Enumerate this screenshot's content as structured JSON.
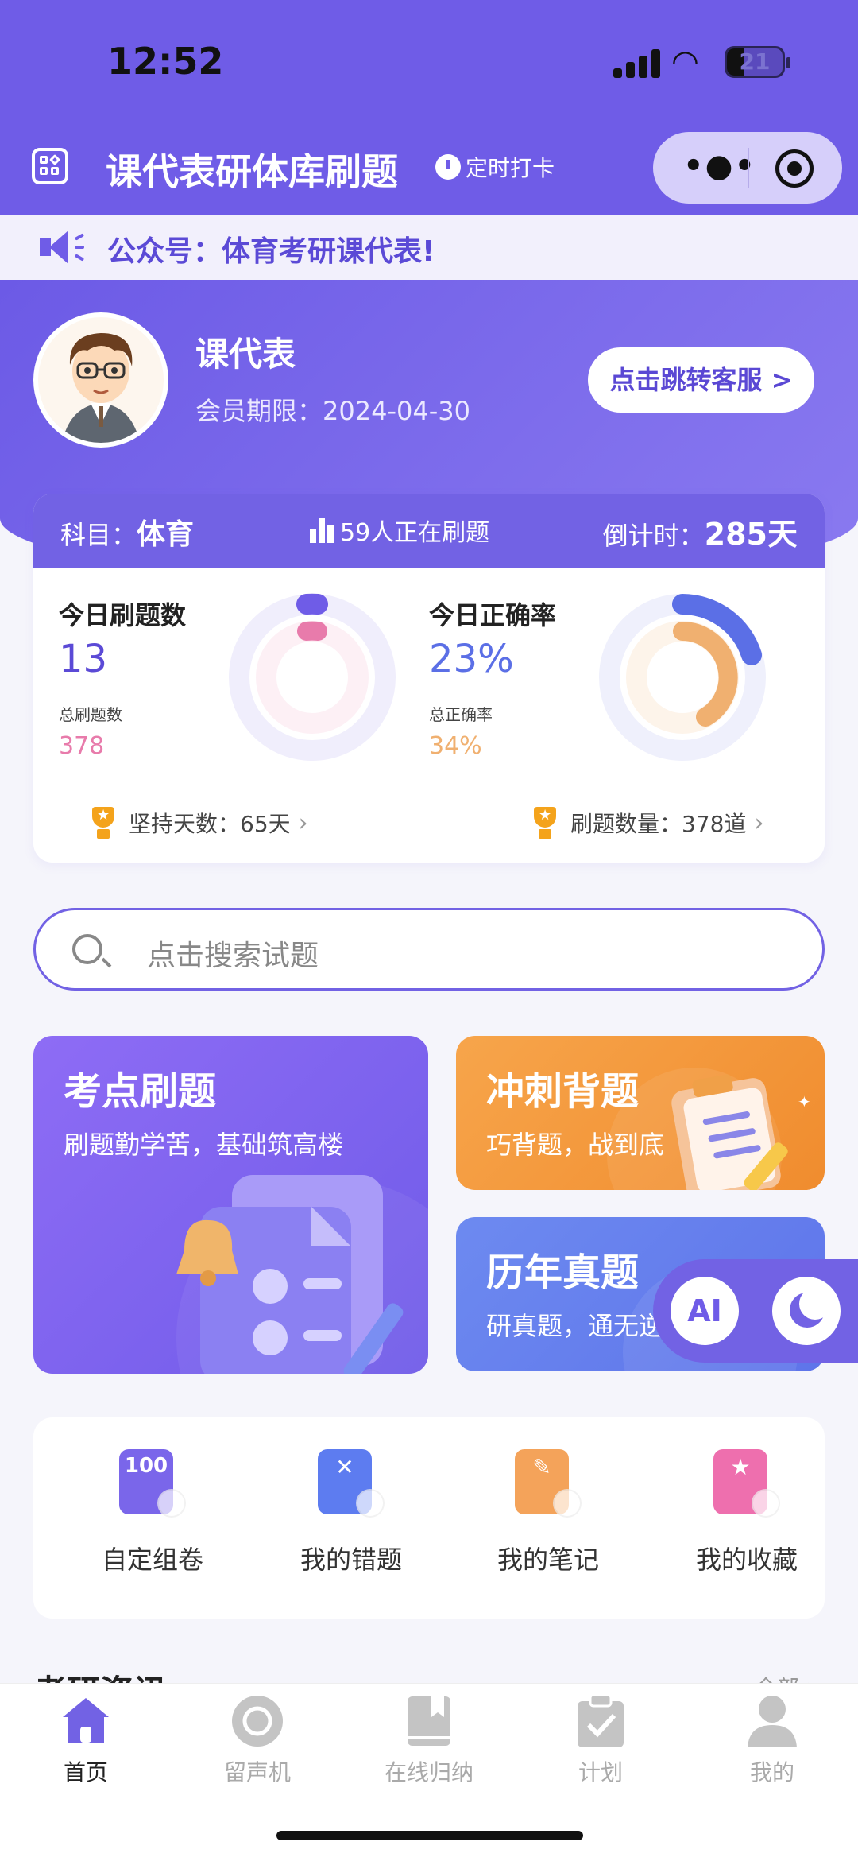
{
  "status_bar": {
    "time": "12:52",
    "battery": "21"
  },
  "header": {
    "title": "课代表研体库刷题",
    "checkin": "定时打卡"
  },
  "notice": {
    "text": "公众号：体育考研课代表!"
  },
  "profile": {
    "name": "课代表",
    "membership": "会员期限：2024-04-30",
    "service_button": "点击跳转客服 >"
  },
  "stats": {
    "subject_label": "科目：",
    "subject": "体育",
    "active": "59人正在刷题",
    "countdown_label": "倒计时：",
    "countdown": "285天",
    "today_count_label": "今日刷题数",
    "today_count": "13",
    "total_count_label": "总刷题数",
    "total_count": "378",
    "today_accuracy_label": "今日正确率",
    "today_accuracy": "23%",
    "total_accuracy_label": "总正确率",
    "total_accuracy": "34%",
    "streak": "坚持天数：65天",
    "question_total": "刷题数量：378道",
    "colors": {
      "primary": "#6f5ce7",
      "pink": "#e87bab",
      "orange": "#f0b070",
      "blue": "#5b6fe6"
    }
  },
  "search": {
    "placeholder": "点击搜索试题"
  },
  "features": [
    {
      "title": "考点刷题",
      "subtitle": "刷题勤学苦，基础筑高楼"
    },
    {
      "title": "冲刺背题",
      "subtitle": "巧背题，战到底"
    },
    {
      "title": "历年真题",
      "subtitle": "研真题，通无逆"
    }
  ],
  "float": {
    "ai": "AI"
  },
  "tools": [
    {
      "label": "自定组卷",
      "icon": "exam-icon",
      "symbol": "100",
      "color": "#7a66ea"
    },
    {
      "label": "我的错题",
      "icon": "wrong-icon",
      "symbol": "✕",
      "color": "#5d7cf0"
    },
    {
      "label": "我的笔记",
      "icon": "note-icon",
      "symbol": "✎",
      "color": "#f4a35a"
    },
    {
      "label": "我的收藏",
      "icon": "favorite-icon",
      "symbol": "★",
      "color": "#ee6fae"
    }
  ],
  "news": {
    "title": "考研资讯",
    "more": "全部 >"
  },
  "tabbar": [
    {
      "label": "首页",
      "icon": "home-icon"
    },
    {
      "label": "留声机",
      "icon": "record-icon"
    },
    {
      "label": "在线归纳",
      "icon": "book-icon"
    },
    {
      "label": "计划",
      "icon": "clipboard-icon"
    },
    {
      "label": "我的",
      "icon": "profile-icon"
    }
  ]
}
